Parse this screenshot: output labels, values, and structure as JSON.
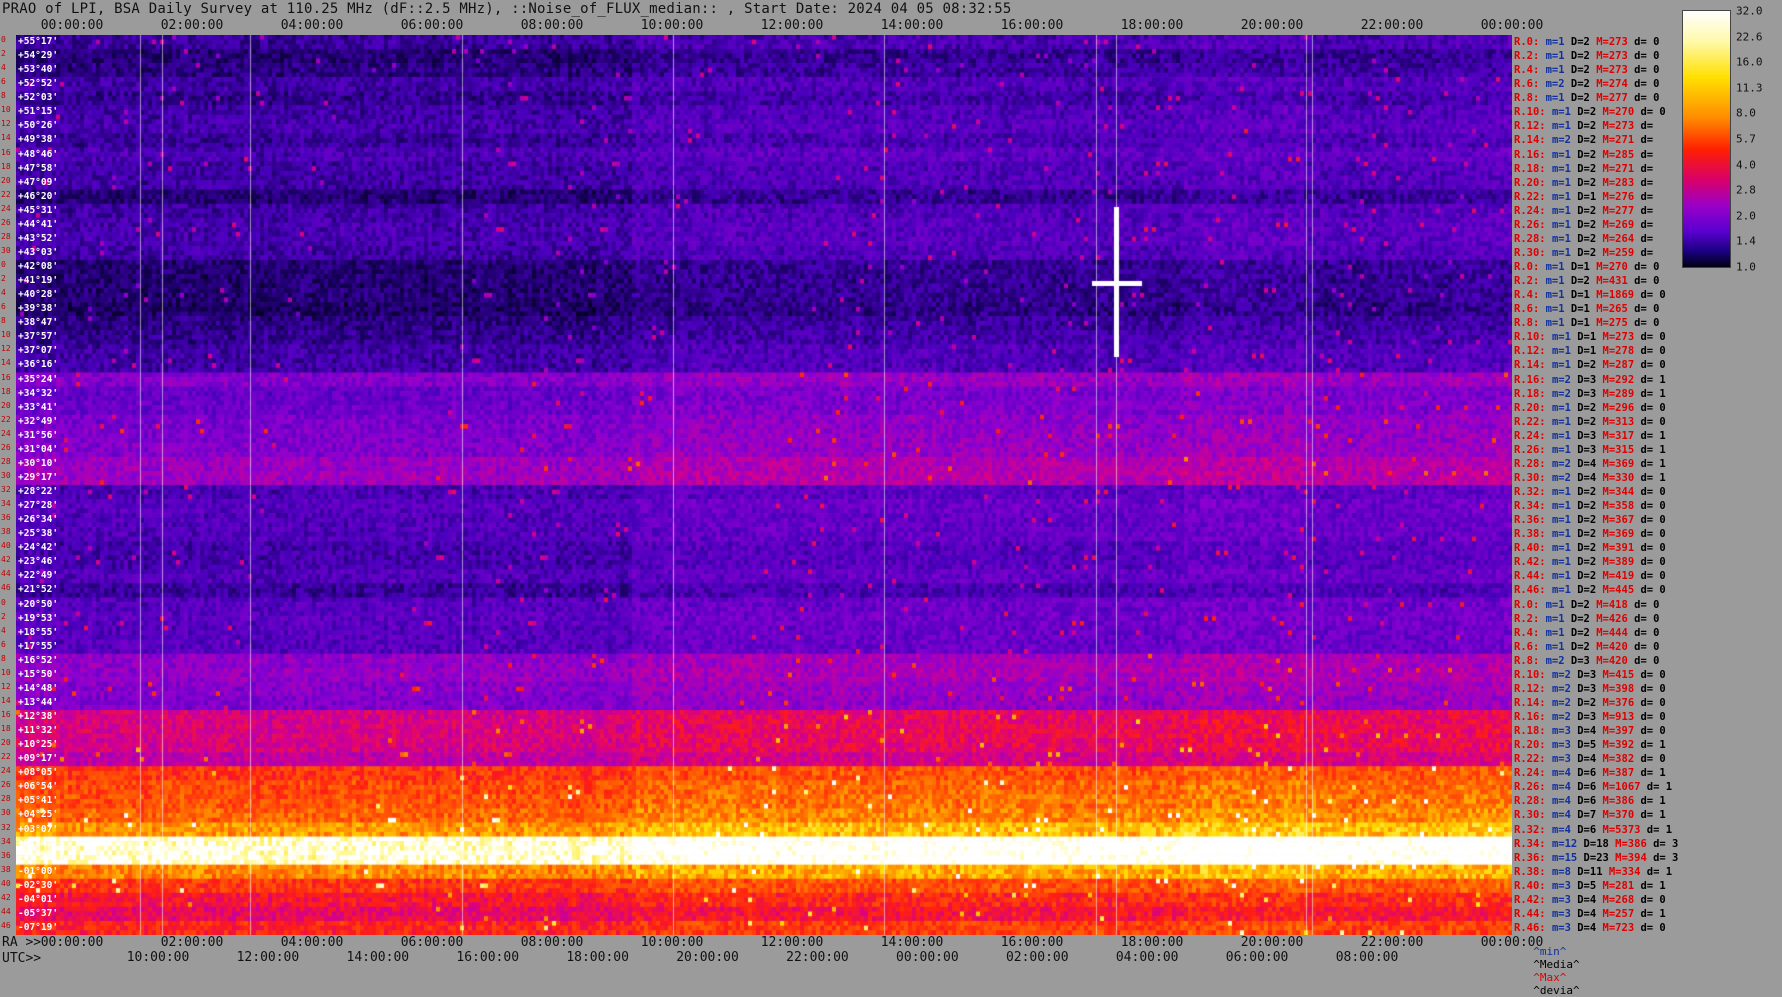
{
  "title": "PRAO of LPI, BSA Daily Survey at 110.25 MHz (dF::2.5 MHz), ::Noise_of_FLUX_median:: , Start Date: 2024 04 05 08:32:55",
  "axis_prefix": {
    "ra": "RA >>",
    "utc": "UTC>>"
  },
  "chart_data": {
    "type": "heatmap",
    "title": "PRAO of LPI, BSA Daily Survey at 110.25 MHz (dF::2.5 MHz), ::Noise_of_FLUX_median:: , Start Date: 2024 04 05 08:32:55",
    "top_ticks": [
      "00:00:00",
      "02:00:00",
      "04:00:00",
      "06:00:00",
      "08:00:00",
      "10:00:00",
      "12:00:00",
      "14:00:00",
      "16:00:00",
      "18:00:00",
      "20:00:00",
      "22:00:00",
      "00:00:00"
    ],
    "ra_ticks": [
      "00:00:00",
      "02:00:00",
      "04:00:00",
      "06:00:00",
      "08:00:00",
      "10:00:00",
      "12:00:00",
      "14:00:00",
      "16:00:00",
      "18:00:00",
      "20:00:00",
      "22:00:00",
      "00:00:00"
    ],
    "utc_ticks": [
      "10:00:00",
      "12:00:00",
      "14:00:00",
      "16:00:00",
      "18:00:00",
      "20:00:00",
      "22:00:00",
      "00:00:00",
      "02:00:00",
      "04:00:00",
      "06:00:00",
      "08:00:00"
    ],
    "dec_labels": [
      "+55°17'",
      "+54°29'",
      "+53°40'",
      "+52°52'",
      "+52°03'",
      "+51°15'",
      "+50°26'",
      "+49°38'",
      "+48°46'",
      "+47°58'",
      "+47°09'",
      "+46°20'",
      "+45°31'",
      "+44°41'",
      "+43°52'",
      "+43°03'",
      "+42°08'",
      "+41°19'",
      "+40°28'",
      "+39°38'",
      "+38°47'",
      "+37°57'",
      "+37°07'",
      "+36°16'",
      "+35°24'",
      "+34°32'",
      "+33°41'",
      "+32°49'",
      "+31°56'",
      "+31°04'",
      "+30°10'",
      "+29°17'",
      "+28°22'",
      "+27°28'",
      "+26°34'",
      "+25°38'",
      "+24°42'",
      "+23°46'",
      "+22°49'",
      "+21°52'",
      "+20°50'",
      "+19°53'",
      "+18°55'",
      "+17°55'",
      "+16°52'",
      "+15°50'",
      "+14°48'",
      "+13°44'",
      "+12°38'",
      "+11°32'",
      "+10°25'",
      "+09°17'",
      "+08°05'",
      "+06°54'",
      "+05°41'",
      "+04°25'",
      "+03°07'",
      "+01°47'",
      "+00°25'",
      "-01°00'",
      "-02°30'",
      "-04°01'",
      "-05°37'",
      "-07°19'"
    ],
    "row_numbers": [
      "0",
      "2",
      "4",
      "6",
      "8",
      "10",
      "12",
      "14",
      "16",
      "18",
      "20",
      "22",
      "24",
      "26",
      "28",
      "30",
      "0",
      "2",
      "4",
      "6",
      "8",
      "10",
      "12",
      "14",
      "16",
      "18",
      "20",
      "22",
      "24",
      "26",
      "28",
      "30",
      "32",
      "34",
      "36",
      "38",
      "40",
      "42",
      "44",
      "46",
      "0",
      "2",
      "4",
      "6",
      "8",
      "10",
      "12",
      "14",
      "16",
      "18",
      "20",
      "22",
      "24",
      "26",
      "28",
      "30",
      "32",
      "34",
      "36",
      "38",
      "40",
      "42",
      "44",
      "46"
    ],
    "row_stats": [
      {
        "r": "R.0:",
        "m": "1",
        "d": "2",
        "max": "273",
        "dev": "0"
      },
      {
        "r": "R.2:",
        "m": "1",
        "d": "2",
        "max": "273",
        "dev": "0"
      },
      {
        "r": "R.4:",
        "m": "1",
        "d": "2",
        "max": "273",
        "dev": "0"
      },
      {
        "r": "R.6:",
        "m": "2",
        "d": "2",
        "max": "274",
        "dev": "0"
      },
      {
        "r": "R.8:",
        "m": "1",
        "d": "2",
        "max": "277",
        "dev": "0"
      },
      {
        "r": "R.10:",
        "m": "1",
        "d": "2",
        "max": "270",
        "dev": "0"
      },
      {
        "r": "R.12:",
        "m": "1",
        "d": "2",
        "max": "273",
        "dev": ""
      },
      {
        "r": "R.14:",
        "m": "2",
        "d": "2",
        "max": "271",
        "dev": ""
      },
      {
        "r": "R.16:",
        "m": "1",
        "d": "2",
        "max": "285",
        "dev": ""
      },
      {
        "r": "R.18:",
        "m": "1",
        "d": "2",
        "max": "271",
        "dev": ""
      },
      {
        "r": "R.20:",
        "m": "1",
        "d": "2",
        "max": "283",
        "dev": ""
      },
      {
        "r": "R.22:",
        "m": "1",
        "d": "1",
        "max": "276",
        "dev": ""
      },
      {
        "r": "R.24:",
        "m": "1",
        "d": "2",
        "max": "277",
        "dev": ""
      },
      {
        "r": "R.26:",
        "m": "1",
        "d": "2",
        "max": "269",
        "dev": ""
      },
      {
        "r": "R.28:",
        "m": "1",
        "d": "2",
        "max": "264",
        "dev": ""
      },
      {
        "r": "R.30:",
        "m": "1",
        "d": "2",
        "max": "259",
        "dev": ""
      },
      {
        "r": "R.0:",
        "m": "1",
        "d": "1",
        "max": "270",
        "dev": "0"
      },
      {
        "r": "R.2:",
        "m": "1",
        "d": "2",
        "max": "431",
        "dev": "0"
      },
      {
        "r": "R.4:",
        "m": "1",
        "d": "1",
        "max": "1869",
        "dev": "0"
      },
      {
        "r": "R.6:",
        "m": "1",
        "d": "1",
        "max": "265",
        "dev": "0"
      },
      {
        "r": "R.8:",
        "m": "1",
        "d": "1",
        "max": "275",
        "dev": "0"
      },
      {
        "r": "R.10:",
        "m": "1",
        "d": "1",
        "max": "273",
        "dev": "0"
      },
      {
        "r": "R.12:",
        "m": "1",
        "d": "1",
        "max": "278",
        "dev": "0"
      },
      {
        "r": "R.14:",
        "m": "1",
        "d": "2",
        "max": "287",
        "dev": "0"
      },
      {
        "r": "R.16:",
        "m": "2",
        "d": "3",
        "max": "292",
        "dev": "1"
      },
      {
        "r": "R.18:",
        "m": "2",
        "d": "3",
        "max": "289",
        "dev": "1"
      },
      {
        "r": "R.20:",
        "m": "1",
        "d": "2",
        "max": "296",
        "dev": "0"
      },
      {
        "r": "R.22:",
        "m": "1",
        "d": "2",
        "max": "313",
        "dev": "0"
      },
      {
        "r": "R.24:",
        "m": "1",
        "d": "3",
        "max": "317",
        "dev": "1"
      },
      {
        "r": "R.26:",
        "m": "1",
        "d": "3",
        "max": "315",
        "dev": "1"
      },
      {
        "r": "R.28:",
        "m": "2",
        "d": "4",
        "max": "369",
        "dev": "1"
      },
      {
        "r": "R.30:",
        "m": "2",
        "d": "4",
        "max": "330",
        "dev": "1"
      },
      {
        "r": "R.32:",
        "m": "1",
        "d": "2",
        "max": "344",
        "dev": "0"
      },
      {
        "r": "R.34:",
        "m": "1",
        "d": "2",
        "max": "358",
        "dev": "0"
      },
      {
        "r": "R.36:",
        "m": "1",
        "d": "2",
        "max": "367",
        "dev": "0"
      },
      {
        "r": "R.38:",
        "m": "1",
        "d": "2",
        "max": "369",
        "dev": "0"
      },
      {
        "r": "R.40:",
        "m": "1",
        "d": "2",
        "max": "391",
        "dev": "0"
      },
      {
        "r": "R.42:",
        "m": "1",
        "d": "2",
        "max": "389",
        "dev": "0"
      },
      {
        "r": "R.44:",
        "m": "1",
        "d": "2",
        "max": "419",
        "dev": "0"
      },
      {
        "r": "R.46:",
        "m": "1",
        "d": "2",
        "max": "445",
        "dev": "0"
      },
      {
        "r": "R.0:",
        "m": "1",
        "d": "2",
        "max": "418",
        "dev": "0"
      },
      {
        "r": "R.2:",
        "m": "1",
        "d": "2",
        "max": "426",
        "dev": "0"
      },
      {
        "r": "R.4:",
        "m": "1",
        "d": "2",
        "max": "444",
        "dev": "0"
      },
      {
        "r": "R.6:",
        "m": "1",
        "d": "2",
        "max": "420",
        "dev": "0"
      },
      {
        "r": "R.8:",
        "m": "2",
        "d": "3",
        "max": "420",
        "dev": "0"
      },
      {
        "r": "R.10:",
        "m": "2",
        "d": "3",
        "max": "415",
        "dev": "0"
      },
      {
        "r": "R.12:",
        "m": "2",
        "d": "3",
        "max": "398",
        "dev": "0"
      },
      {
        "r": "R.14:",
        "m": "2",
        "d": "2",
        "max": "376",
        "dev": "0"
      },
      {
        "r": "R.16:",
        "m": "2",
        "d": "3",
        "max": "913",
        "dev": "0"
      },
      {
        "r": "R.18:",
        "m": "3",
        "d": "4",
        "max": "397",
        "dev": "0"
      },
      {
        "r": "R.20:",
        "m": "3",
        "d": "5",
        "max": "392",
        "dev": "1"
      },
      {
        "r": "R.22:",
        "m": "3",
        "d": "4",
        "max": "382",
        "dev": "0"
      },
      {
        "r": "R.24:",
        "m": "4",
        "d": "6",
        "max": "387",
        "dev": "1"
      },
      {
        "r": "R.26:",
        "m": "4",
        "d": "6",
        "max": "1067",
        "dev": "1"
      },
      {
        "r": "R.28:",
        "m": "4",
        "d": "6",
        "max": "386",
        "dev": "1"
      },
      {
        "r": "R.30:",
        "m": "4",
        "d": "7",
        "max": "370",
        "dev": "1"
      },
      {
        "r": "R.32:",
        "m": "4",
        "d": "6",
        "max": "5373",
        "dev": "1"
      },
      {
        "r": "R.34:",
        "m": "12",
        "d": "18",
        "max": "386",
        "dev": "3"
      },
      {
        "r": "R.36:",
        "m": "15",
        "d": "23",
        "max": "394",
        "dev": "3"
      },
      {
        "r": "R.38:",
        "m": "8",
        "d": "11",
        "max": "334",
        "dev": "1"
      },
      {
        "r": "R.40:",
        "m": "3",
        "d": "5",
        "max": "281",
        "dev": "1"
      },
      {
        "r": "R.42:",
        "m": "3",
        "d": "4",
        "max": "268",
        "dev": "0"
      },
      {
        "r": "R.44:",
        "m": "3",
        "d": "4",
        "max": "257",
        "dev": "1"
      },
      {
        "r": "R.46:",
        "m": "3",
        "d": "4",
        "max": "723",
        "dev": "0"
      }
    ],
    "row_stat_keys": {
      "m": "m=",
      "d": "D=",
      "max": "M=",
      "dev": "d="
    },
    "footer": {
      "min": "^min^",
      "median": "^Media^",
      "max": "^Max^",
      "dev": "^devia^"
    },
    "colorbar": {
      "ticks": [
        "32.0",
        "22.6",
        "16.0",
        "11.3",
        "8.0",
        "5.7",
        "4.0",
        "2.8",
        "2.0",
        "1.4",
        "1.0"
      ],
      "scale": "log",
      "range": [
        1.0,
        32.0
      ]
    },
    "row_levels": [
      1.8,
      1.5,
      1.6,
      1.9,
      1.7,
      1.9,
      2.0,
      1.8,
      2.1,
      1.9,
      1.9,
      1.5,
      1.9,
      2.0,
      2.0,
      1.9,
      1.5,
      1.5,
      1.5,
      1.4,
      1.6,
      1.7,
      1.9,
      1.9,
      3.2,
      2.6,
      2.7,
      3.0,
      3.1,
      3.2,
      3.8,
      3.9,
      2.1,
      2.3,
      2.2,
      2.2,
      2.0,
      2.0,
      2.2,
      1.8,
      2.3,
      2.4,
      2.3,
      2.3,
      3.5,
      3.6,
      3.3,
      3.1,
      5.6,
      5.7,
      5.6,
      4.8,
      9.5,
      10.5,
      11.0,
      12.0,
      15.0,
      30.0,
      30.0,
      14.0,
      9.5,
      7.5,
      6.5,
      8.5
    ],
    "right_brightening_start_fraction": 0.41,
    "colors": {
      "background": "#9b9b9b",
      "stat_red": "#e00000",
      "stat_blue": "#1030a0"
    }
  }
}
